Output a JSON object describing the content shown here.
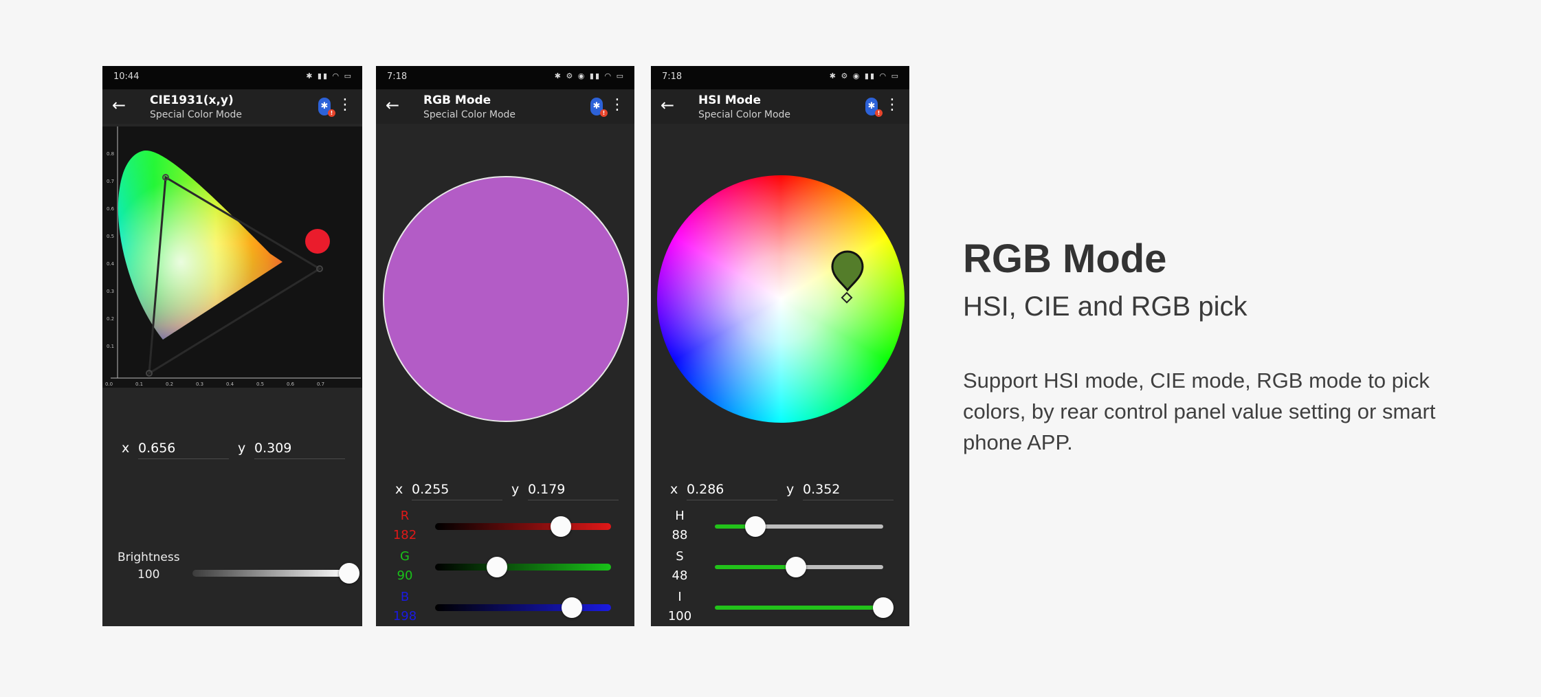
{
  "phones": [
    {
      "status_time": "10:44",
      "title": "CIE1931(x,y)",
      "subtitle": "Special Color Mode",
      "x_label": "x",
      "x_value": "0.656",
      "y_label": "y",
      "y_value": "0.309",
      "y_ticks": [
        "0.8",
        "0.7",
        "0.6",
        "0.5",
        "0.4",
        "0.3",
        "0.2",
        "0.1"
      ],
      "x_ticks": [
        "0.0",
        "0.1",
        "0.2",
        "0.3",
        "0.4",
        "0.5",
        "0.6",
        "0.7"
      ],
      "brightness_label": "Brightness",
      "brightness_value": "100",
      "brightness_level": 1.0
    },
    {
      "status_time": "7:18",
      "title": "RGB Mode",
      "subtitle": "Special Color Mode",
      "swatch_color": "#b35cc6",
      "x_label": "x",
      "x_value": "0.255",
      "y_label": "y",
      "y_value": "0.179",
      "sliders": [
        {
          "label": "R",
          "value": "182",
          "color": "#e01818",
          "level": 0.714
        },
        {
          "label": "G",
          "value": "90",
          "color": "#19c319",
          "level": 0.353
        },
        {
          "label": "B",
          "value": "198",
          "color": "#1a1ae0",
          "level": 0.776
        }
      ]
    },
    {
      "status_time": "7:18",
      "title": "HSI Mode",
      "subtitle": "Special Color Mode",
      "marker_color": "#547d2a",
      "x_label": "x",
      "x_value": "0.286",
      "y_label": "y",
      "y_value": "0.352",
      "sliders": [
        {
          "label": "H",
          "value": "88",
          "color": "#ffffff",
          "level": 0.24
        },
        {
          "label": "S",
          "value": "48",
          "color": "#ffffff",
          "level": 0.48
        },
        {
          "label": "I",
          "value": "100",
          "color": "#ffffff",
          "level": 1.0
        }
      ]
    }
  ],
  "content": {
    "title": "RGB Mode",
    "subtitle": "HSI, CIE and RGB pick",
    "description": "Support HSI mode, CIE mode, RGB mode to pick colors, by rear control panel value setting or smart phone APP."
  },
  "colors": {
    "page_bg": "#f6f6f6",
    "phone_bg": "#262626",
    "slider_green": "#22c21a"
  },
  "icons": [
    "back-arrow-icon",
    "bluetooth-icon",
    "more-vert-icon",
    "bluetooth-icon",
    "wifi-icon",
    "battery-icon"
  ]
}
